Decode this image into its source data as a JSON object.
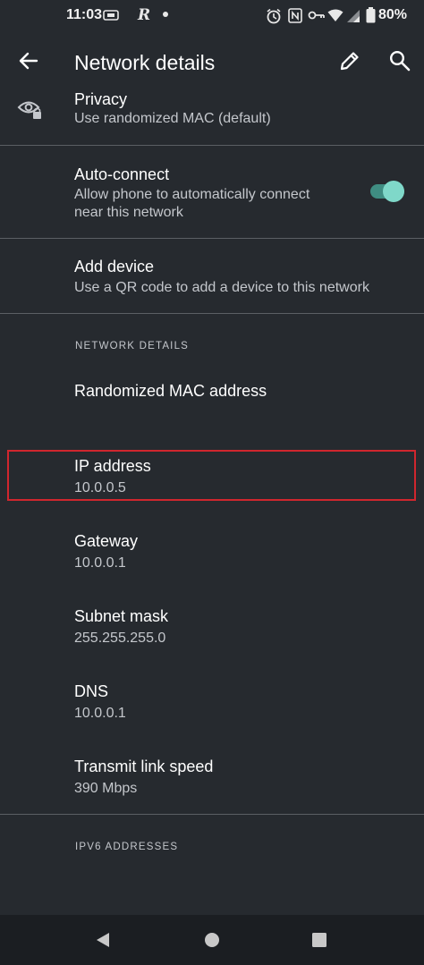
{
  "status_bar": {
    "time": "11:03",
    "battery": "80%",
    "icons": [
      "sim-icon",
      "r-app-icon",
      "dot-icon",
      "alarm-icon",
      "nfc-icon",
      "key-icon",
      "wifi-icon",
      "signal-icon",
      "battery-icon"
    ]
  },
  "app_bar": {
    "title": "Network details",
    "icons": [
      "back-arrow-icon",
      "edit-pencil-icon",
      "search-icon"
    ]
  },
  "rows": {
    "privacy": {
      "title": "Privacy",
      "subtitle": "Use randomized MAC (default)",
      "icon": "eye-lock-icon"
    },
    "auto_connect": {
      "title": "Auto-connect",
      "subtitle_line1": "Allow phone to automatically connect",
      "subtitle_line2": "near this network",
      "toggle_on": true
    },
    "add_device": {
      "title": "Add device",
      "subtitle": "Use a QR code to add a device to this network"
    }
  },
  "network_details": {
    "header": "NETWORK DETAILS",
    "mac": {
      "label": "Randomized MAC address"
    },
    "ip": {
      "label": "IP address",
      "value": "10.0.0.5"
    },
    "gateway": {
      "label": "Gateway",
      "value": "10.0.0.1"
    },
    "subnet": {
      "label": "Subnet mask",
      "value": "255.255.255.0"
    },
    "dns": {
      "label": "DNS",
      "value": "10.0.0.1"
    },
    "link_speed": {
      "label": "Transmit link speed",
      "value": "390 Mbps"
    }
  },
  "ipv6": {
    "header": "IPV6 ADDRESSES"
  },
  "colors": {
    "background": "#262a2f",
    "toggle_accent": "#7fd8c9",
    "highlight": "#d0262e"
  },
  "nav_bar": {
    "icons": [
      "back-triangle-icon",
      "home-circle-icon",
      "recents-square-icon"
    ]
  }
}
